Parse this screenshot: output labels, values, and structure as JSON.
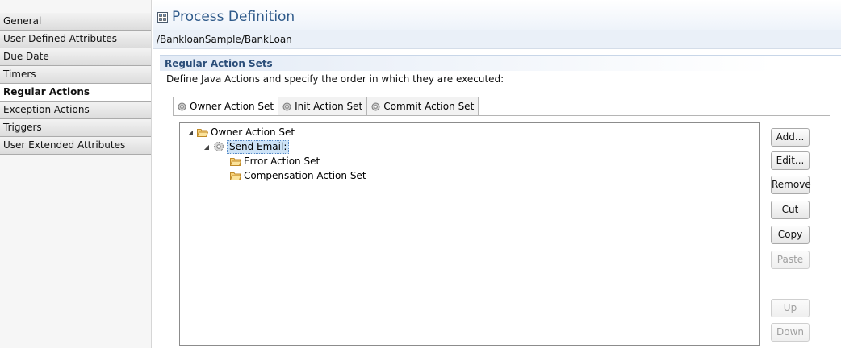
{
  "sidebar": {
    "items": [
      {
        "label": "General"
      },
      {
        "label": "User Defined Attributes"
      },
      {
        "label": "Due Date"
      },
      {
        "label": "Timers"
      },
      {
        "label": "Regular Actions",
        "active": true
      },
      {
        "label": "Exception Actions"
      },
      {
        "label": "Triggers"
      },
      {
        "label": "User Extended Attributes"
      }
    ]
  },
  "header": {
    "title": "Process Definition",
    "path": "/BankloanSample/BankLoan"
  },
  "section": {
    "title": "Regular Action Sets",
    "description": "Define Java Actions and specify the order in which they are executed:"
  },
  "tabs": [
    {
      "label": "Owner Action Set",
      "active": true
    },
    {
      "label": "Init Action Set"
    },
    {
      "label": "Commit Action Set"
    }
  ],
  "tree": {
    "root": "Owner Action Set",
    "action": "Send Email:",
    "error_set": "Error Action Set",
    "compensation_set": "Compensation Action Set"
  },
  "buttons": {
    "add": "Add...",
    "edit": "Edit...",
    "remove": "Remove",
    "cut": "Cut",
    "copy": "Copy",
    "paste": "Paste",
    "up": "Up",
    "down": "Down"
  },
  "colors": {
    "title": "#2f5a8a",
    "section_title": "#2b4e79",
    "selection": "#cde3f7",
    "folder": "#e8a93c"
  }
}
